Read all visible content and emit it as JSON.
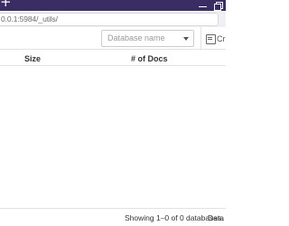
{
  "browser": {
    "url": "0.0.1:5984/_utils/",
    "new_tab_icon": "plus-icon",
    "controls": [
      "minimize-icon",
      "restore-icon"
    ]
  },
  "toolbar": {
    "database_select_placeholder": "Database name",
    "create_button_label": "Cr",
    "create_button_icon": "database-icon"
  },
  "table": {
    "columns": [
      "Size",
      "# of Docs"
    ],
    "rows": []
  },
  "footer": {
    "status": "Showing 1–0 of 0 databases.",
    "extra": "Data"
  },
  "colors": {
    "titlebar": "#3a2d63",
    "urlbar": "#f0f0f4",
    "border": "#e2e2e2"
  }
}
